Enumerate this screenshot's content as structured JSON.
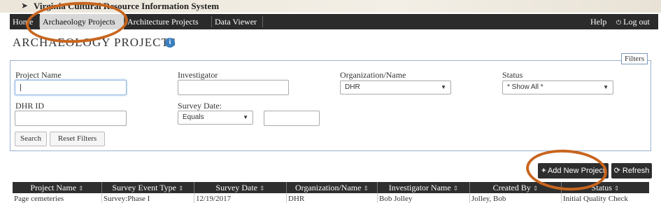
{
  "banner": {
    "title": "Virginia Cultural Resource Information System"
  },
  "nav": {
    "home": "Home",
    "archaeology": "Archaeology Projects",
    "architecture": "Architecture Projects",
    "data_viewer": "Data Viewer",
    "help": "Help",
    "logout": "Log out"
  },
  "page": {
    "title": "ARCHAEOLOGY PROJECTS",
    "info_icon": "i"
  },
  "filters": {
    "legend": "Filters",
    "project_name_label": "Project Name",
    "project_name_value": "|",
    "investigator_label": "Investigator",
    "investigator_value": "",
    "org_label": "Organization/Name",
    "org_value": "DHR",
    "status_label": "Status",
    "status_value": "* Show All *",
    "dhr_id_label": "DHR ID",
    "dhr_id_value": "",
    "survey_date_label": "Survey Date:",
    "survey_date_op": "Equals",
    "survey_date_value": "",
    "search_button": "Search",
    "reset_button": "Reset Filters"
  },
  "actions": {
    "add_new_project": "Add New Project",
    "refresh": "Refresh"
  },
  "table": {
    "columns": [
      "Project Name",
      "Survey Event Type",
      "Survey Date",
      "Organization/Name",
      "Investigator Name",
      "Created By",
      "Status"
    ],
    "rows": [
      [
        "Page cemeteries",
        "Survey:Phase I",
        "12/19/2017",
        "DHR",
        "Bob Jolley",
        "Jolley, Bob",
        "Initial Quality Check"
      ]
    ]
  },
  "colors": {
    "nav_bg": "#2b2b2b",
    "accent_blue": "#3a7fc1",
    "annotation": "#c8651e",
    "filters_border": "#9bb2d1"
  }
}
